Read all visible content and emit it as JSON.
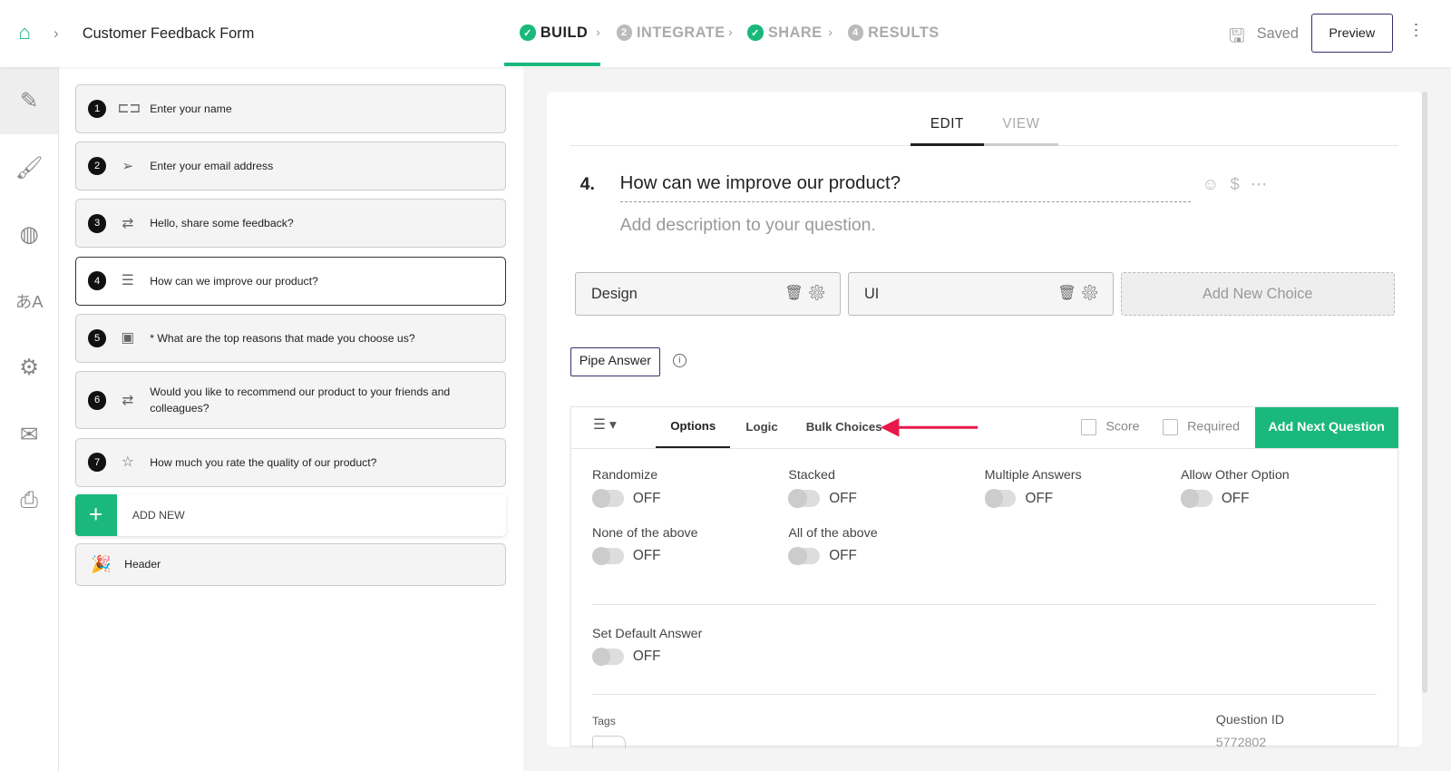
{
  "header": {
    "title": "Customer Feedback Form",
    "steps": [
      {
        "label": "BUILD",
        "badge": "✓"
      },
      {
        "label": "INTEGRATE",
        "badge": "2"
      },
      {
        "label": "SHARE",
        "badge": "✓"
      },
      {
        "label": "RESULTS",
        "badge": "4"
      }
    ],
    "saved": "Saved",
    "preview": "Preview"
  },
  "questions": [
    {
      "n": "1",
      "text": "Enter your name"
    },
    {
      "n": "2",
      "text": "Enter your email address"
    },
    {
      "n": "3",
      "text": "Hello, share some feedback?"
    },
    {
      "n": "4",
      "text": "How can we improve our product?"
    },
    {
      "n": "5",
      "text": "* What are the top reasons that made you choose us?"
    },
    {
      "n": "6",
      "text": "Would you like to recommend our product to your friends and colleagues?"
    },
    {
      "n": "7",
      "text": "How much you rate the quality of our product?"
    }
  ],
  "add_new": "ADD NEW",
  "header_item": "Header",
  "editor": {
    "tabs": [
      "EDIT",
      "VIEW"
    ],
    "q_number": "4.",
    "q_title": "How can we improve our product?",
    "description_placeholder": "Add description to your question.",
    "choices": [
      "Design",
      "UI"
    ],
    "add_choice": "Add New Choice",
    "pipe_answer": "Pipe Answer",
    "subtabs": [
      "Options",
      "Logic",
      "Bulk Choices"
    ],
    "score": "Score",
    "required": "Required",
    "add_next": "Add Next Question",
    "options": [
      {
        "label": "Randomize",
        "state": "OFF"
      },
      {
        "label": "Stacked",
        "state": "OFF"
      },
      {
        "label": "Multiple Answers",
        "state": "OFF"
      },
      {
        "label": "Allow Other Option",
        "state": "OFF"
      },
      {
        "label": "None of the above",
        "state": "OFF"
      },
      {
        "label": "All of the above",
        "state": "OFF"
      }
    ],
    "default_answer": {
      "label": "Set Default Answer",
      "state": "OFF"
    },
    "tags_label": "Tags",
    "qid_label": "Question ID",
    "qid": "5772802"
  },
  "colors": {
    "accent": "#1ab87b",
    "arrow": "#e8184a"
  }
}
